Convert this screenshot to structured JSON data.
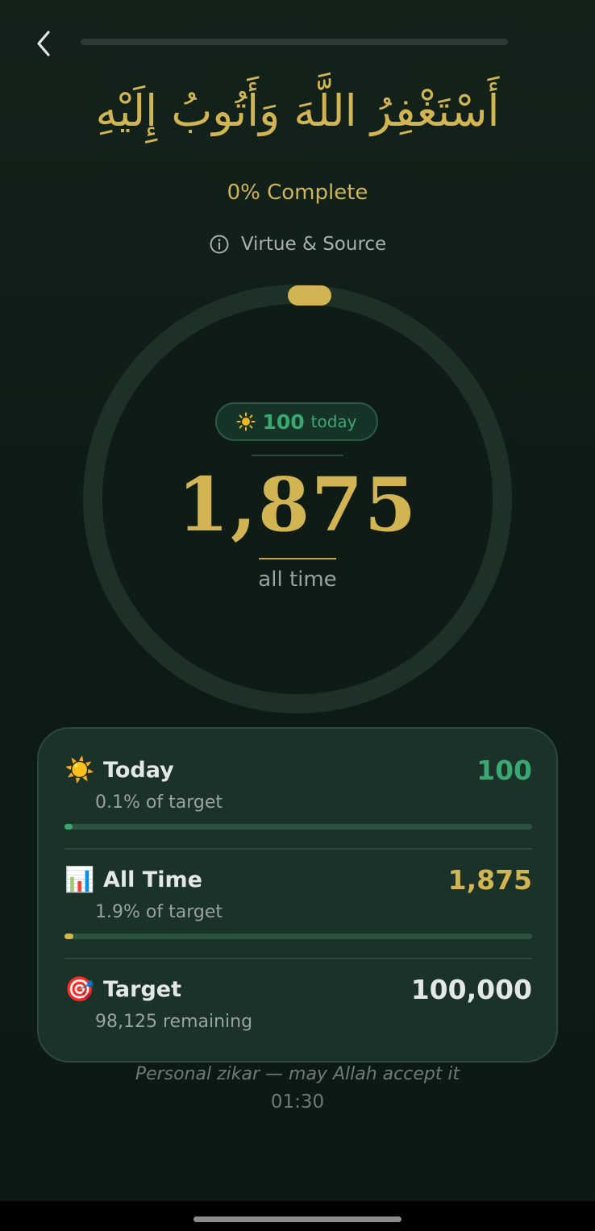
{
  "header": {
    "back_icon": "chevron-left-icon",
    "dhikr_arabic": "أَسْتَغْفِرُ اللَّهَ وَأَتُوبُ إِلَيْهِ",
    "completion_text": "0% Complete",
    "virtue_link": "Virtue & Source",
    "info_icon": "info-circle-icon"
  },
  "counter": {
    "today_icon": "sun-icon",
    "today_value": "100",
    "today_label": "today",
    "all_time_value": "1,875",
    "all_time_label": "all time",
    "ring_progress": 0.0
  },
  "stats": {
    "today": {
      "emoji": "☀️",
      "title": "Today",
      "value": "100",
      "subtitle": "0.1% of target",
      "progress": 0.001
    },
    "all_time": {
      "emoji": "📊",
      "title": "All Time",
      "value": "1,875",
      "subtitle": "1.9% of target",
      "progress": 0.019
    },
    "target": {
      "emoji": "🎯",
      "title": "Target",
      "value": "100,000",
      "subtitle": "98,125 remaining"
    }
  },
  "footer": {
    "note": "Personal zikar — may Allah accept it",
    "time": "01:30"
  },
  "colors": {
    "gold": "#d2b552",
    "green": "#3aa872",
    "white": "#e4e8e5"
  }
}
